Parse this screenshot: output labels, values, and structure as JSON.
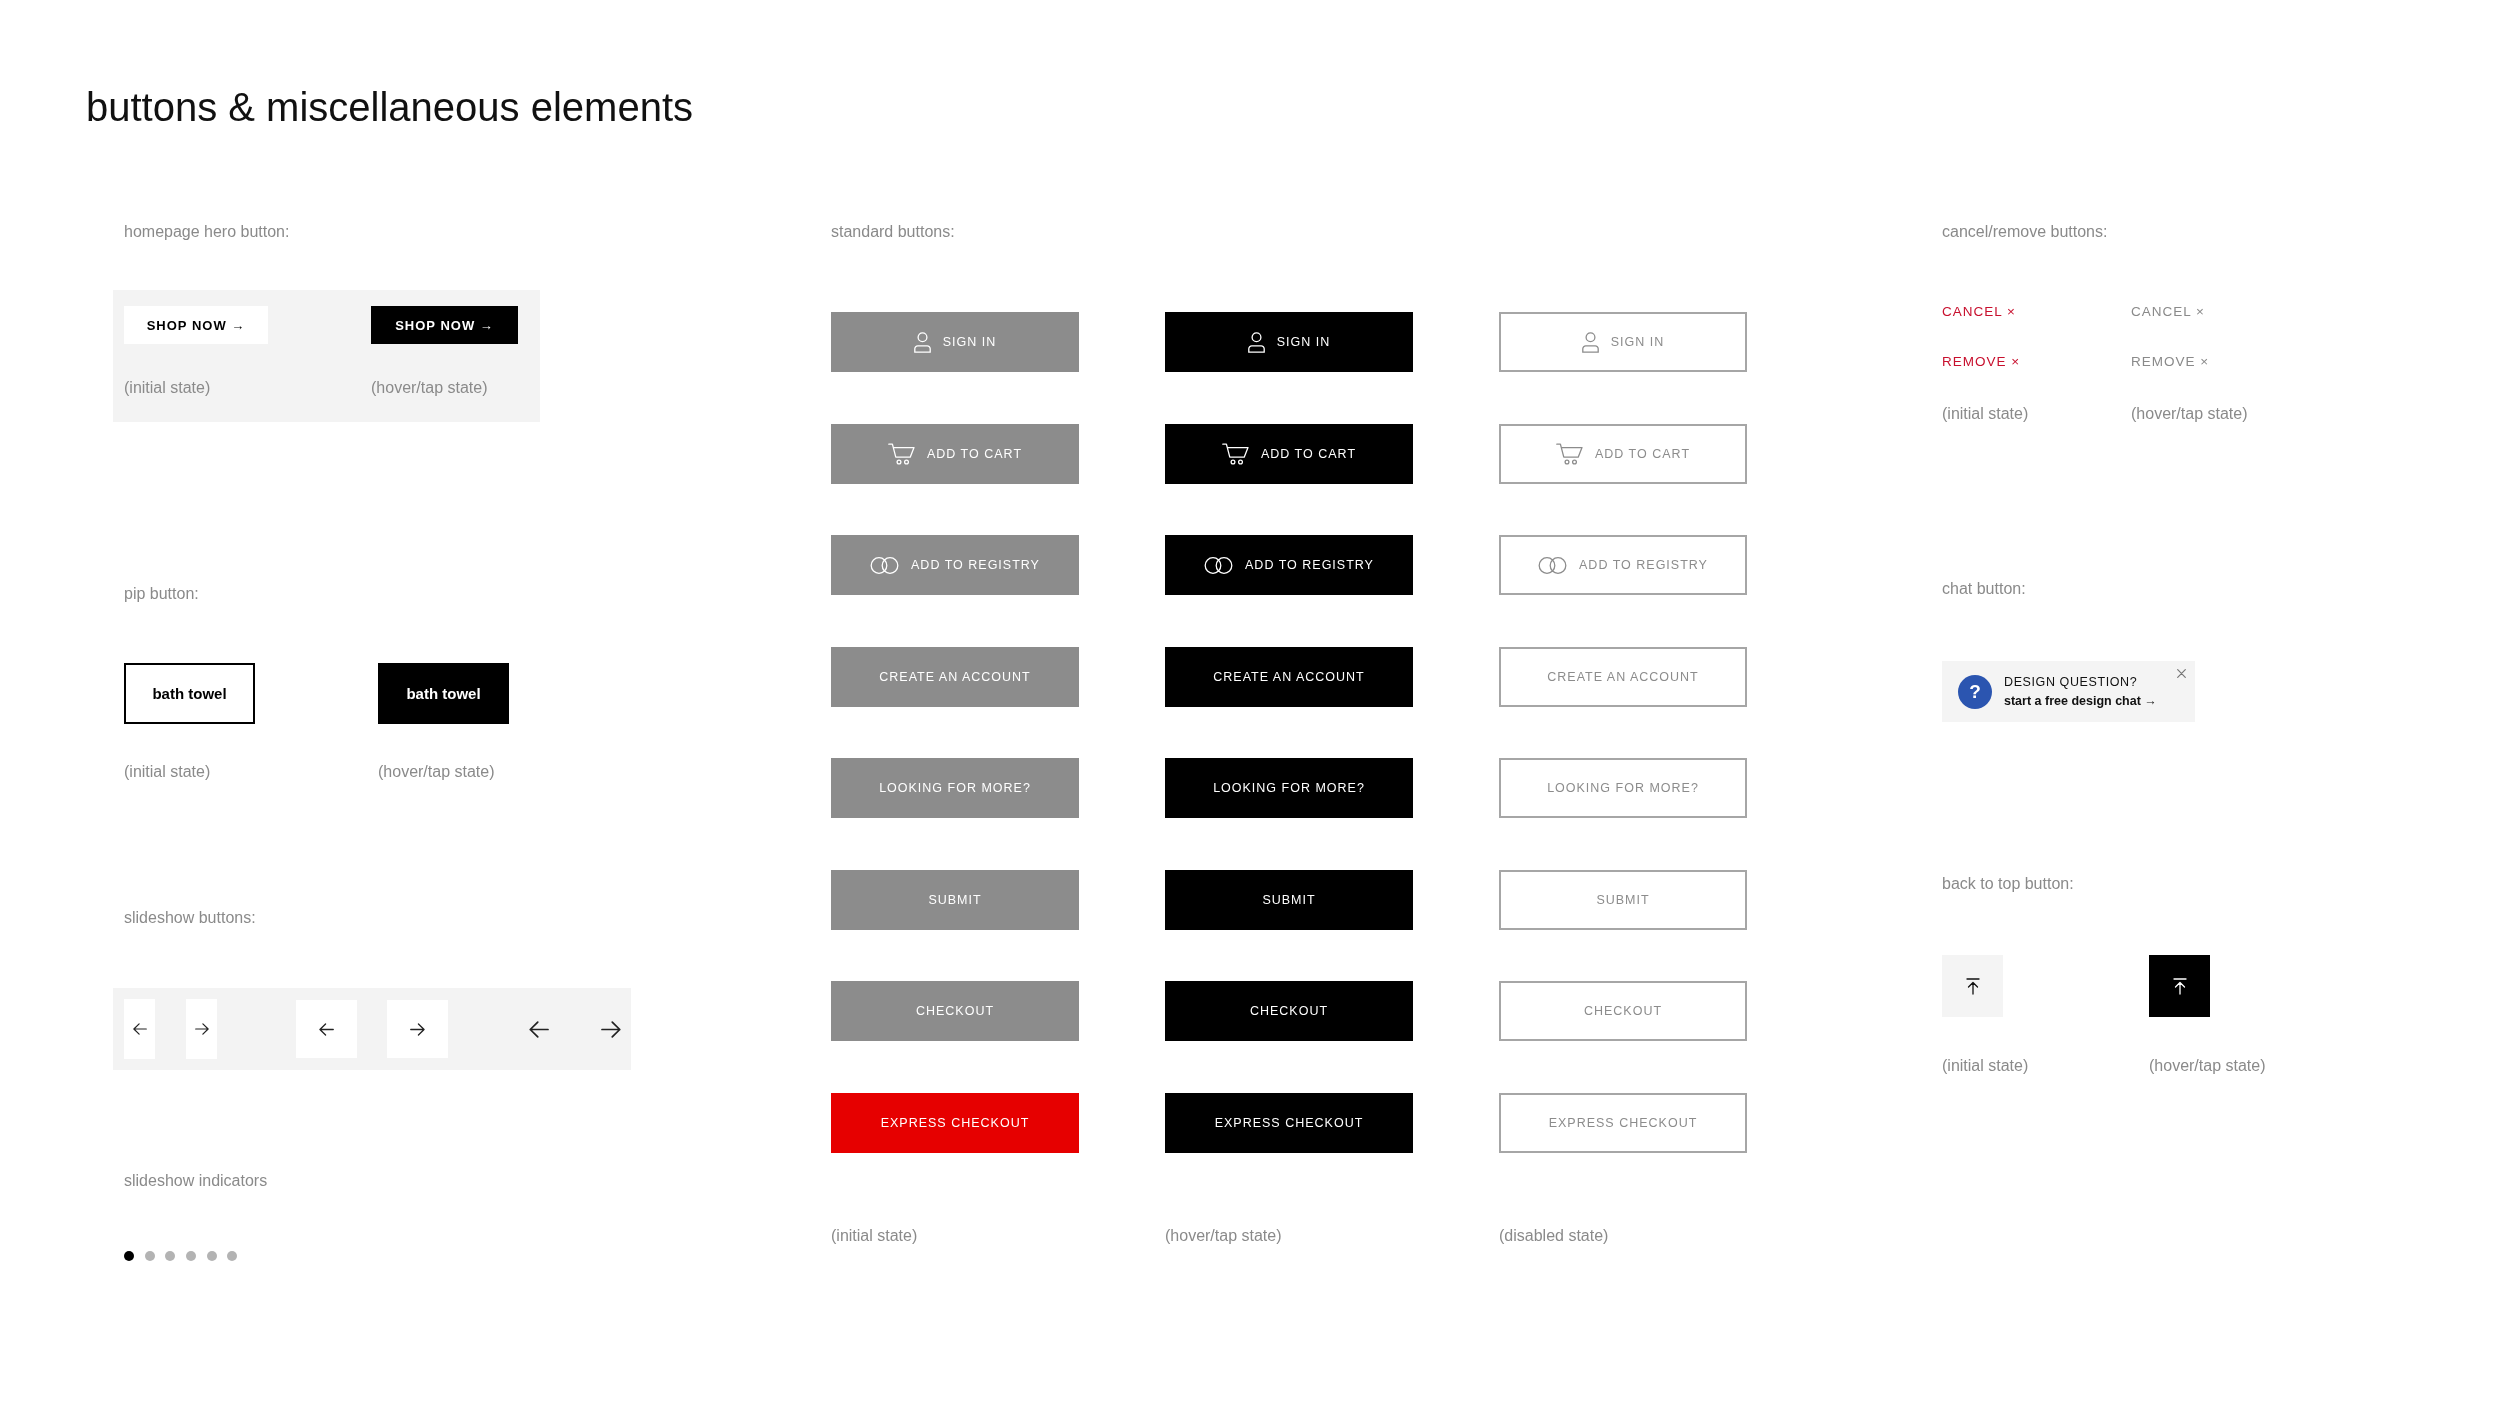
{
  "title": "buttons & miscellaneous elements",
  "hero": {
    "label": "homepage hero button:",
    "buttons": [
      {
        "text": "SHOP NOW →",
        "hovered": false,
        "caption": "(initial state)"
      },
      {
        "text": "SHOP NOW →",
        "hovered": true,
        "caption": "(hover/tap state)"
      }
    ]
  },
  "pip": {
    "label": "pip button:",
    "buttons": [
      {
        "text": "bath towel",
        "hovered": false,
        "caption": "(initial state)"
      },
      {
        "text": "bath towel",
        "hovered": true,
        "caption": "(hover/tap state)"
      }
    ]
  },
  "slideshow": {
    "label": "slideshow buttons:",
    "sets": [
      {
        "kind": "narrow"
      },
      {
        "kind": "square"
      },
      {
        "kind": "bare"
      }
    ]
  },
  "indicators": {
    "label": "slideshow indicators",
    "dots": [
      {
        "selected": true
      },
      {
        "selected": false
      },
      {
        "selected": false
      },
      {
        "selected": false
      },
      {
        "selected": false
      },
      {
        "selected": false
      }
    ]
  },
  "standard": {
    "label": "standard buttons:",
    "columns": [
      {
        "hovered": false,
        "disabled": false,
        "caption": "(initial state)",
        "buttons": [
          {
            "label": "SIGN IN",
            "kind": "account",
            "accent": false
          },
          {
            "label": "ADD TO CART",
            "kind": "cart",
            "accent": false
          },
          {
            "label": "ADD TO REGISTRY",
            "kind": "registry",
            "accent": false
          },
          {
            "label": "CREATE AN ACCOUNT",
            "kind": "text",
            "accent": false
          },
          {
            "label": "LOOKING FOR MORE?",
            "kind": "text",
            "accent": false
          },
          {
            "label": "SUBMIT",
            "kind": "text",
            "accent": false
          },
          {
            "label": "CHECKOUT",
            "kind": "text",
            "accent": false
          },
          {
            "label": "EXPRESS CHECKOUT",
            "kind": "text",
            "accent": true
          }
        ]
      },
      {
        "hovered": true,
        "disabled": false,
        "caption": "(hover/tap state)",
        "buttons": [
          {
            "label": "SIGN IN",
            "kind": "account",
            "accent": false
          },
          {
            "label": "ADD TO CART",
            "kind": "cart",
            "accent": false
          },
          {
            "label": "ADD TO REGISTRY",
            "kind": "registry",
            "accent": false
          },
          {
            "label": "CREATE AN ACCOUNT",
            "kind": "text",
            "accent": false
          },
          {
            "label": "LOOKING FOR MORE?",
            "kind": "text",
            "accent": false
          },
          {
            "label": "SUBMIT",
            "kind": "text",
            "accent": false
          },
          {
            "label": "CHECKOUT",
            "kind": "text",
            "accent": false
          },
          {
            "label": "EXPRESS CHECKOUT",
            "kind": "text",
            "accent": false
          }
        ]
      },
      {
        "hovered": false,
        "disabled": true,
        "caption": "(disabled state)",
        "buttons": [
          {
            "label": "SIGN IN",
            "kind": "account",
            "accent": false
          },
          {
            "label": "ADD TO CART",
            "kind": "cart",
            "accent": false
          },
          {
            "label": "ADD TO REGISTRY",
            "kind": "registry",
            "accent": false
          },
          {
            "label": "CREATE AN ACCOUNT",
            "kind": "text",
            "accent": false
          },
          {
            "label": "LOOKING FOR MORE?",
            "kind": "text",
            "accent": false
          },
          {
            "label": "SUBMIT",
            "kind": "text",
            "accent": false
          },
          {
            "label": "CHECKOUT",
            "kind": "text",
            "accent": false
          },
          {
            "label": "EXPRESS CHECKOUT",
            "kind": "text",
            "accent": false
          }
        ]
      }
    ]
  },
  "cancel": {
    "label": "cancel/remove buttons:",
    "columns": [
      {
        "hovered": false,
        "caption": "(initial state)",
        "items": [
          "CANCEL ×",
          "REMOVE ×"
        ]
      },
      {
        "hovered": true,
        "caption": "(hover/tap state)",
        "items": [
          "CANCEL ×",
          "REMOVE ×"
        ]
      }
    ]
  },
  "chat": {
    "label": "chat button:",
    "badge": "?",
    "heading": "DESIGN QUESTION?",
    "link": "start a free design chat →"
  },
  "back_to_top": {
    "label": "back to top button:",
    "buttons": [
      {
        "hovered": false,
        "caption": "(initial state)"
      },
      {
        "hovered": true,
        "caption": "(hover/tap state)"
      }
    ]
  }
}
